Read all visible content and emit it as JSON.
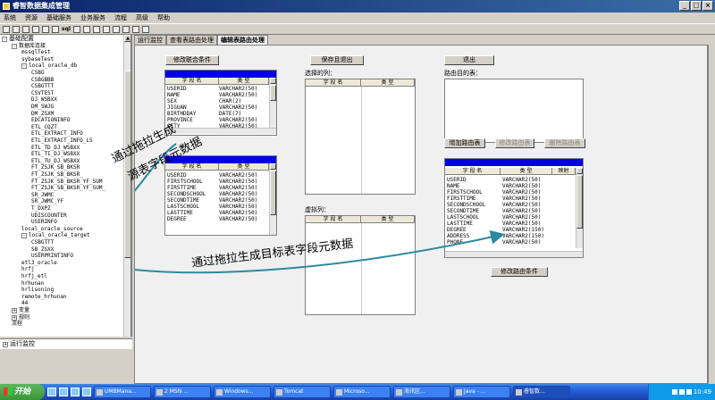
{
  "window": {
    "title": "睿智数据集成管理"
  },
  "menu": [
    "系统",
    "资源",
    "基础服务",
    "业务服务",
    "流程",
    "高级",
    "帮助"
  ],
  "toolbar": {
    "sql_label": "sql"
  },
  "tree": {
    "header": "基础配置",
    "nodes": [
      {
        "label": "基础配置",
        "level": 0,
        "expander": "-",
        "root": true
      },
      {
        "label": "数据库连接",
        "level": 1,
        "expander": "-"
      },
      {
        "label": "mssqlTest",
        "level": 2,
        "expander": ""
      },
      {
        "label": "sybaseTest",
        "level": 2,
        "expander": ""
      },
      {
        "label": "local_oracle_db",
        "level": 2,
        "expander": "-"
      },
      {
        "label": "CSBG",
        "level": 3,
        "expander": ""
      },
      {
        "label": "CSBGBBB",
        "level": 3,
        "expander": ""
      },
      {
        "label": "CSBGTTT",
        "level": 3,
        "expander": ""
      },
      {
        "label": "CSVTEST",
        "level": 3,
        "expander": ""
      },
      {
        "label": "DJ_WSBXX",
        "level": 3,
        "expander": ""
      },
      {
        "label": "DM_SWJG",
        "level": 3,
        "expander": ""
      },
      {
        "label": "DM_ZSXM",
        "level": 3,
        "expander": ""
      },
      {
        "label": "EDCATIONINFO",
        "level": 3,
        "expander": ""
      },
      {
        "label": "ETL_CQZT",
        "level": 3,
        "expander": ""
      },
      {
        "label": "ETL_EXTRACT_INFO",
        "level": 3,
        "expander": ""
      },
      {
        "label": "ETL_EXTRACT_INFO_LS",
        "level": 3,
        "expander": ""
      },
      {
        "label": "ETL_TD_DJ_WSBXX",
        "level": 3,
        "expander": ""
      },
      {
        "label": "ETL_TI_DJ_WSBXX",
        "level": 3,
        "expander": ""
      },
      {
        "label": "ETL_TU_DJ_WSBXX",
        "level": 3,
        "expander": ""
      },
      {
        "label": "FT_ZSJK_SB_BKSR",
        "level": 3,
        "expander": ""
      },
      {
        "label": "FT_ZSJK_SB_BKSR_",
        "level": 3,
        "expander": ""
      },
      {
        "label": "FT_ZSJK_SB_BKSR_YF_SUM",
        "level": 3,
        "expander": ""
      },
      {
        "label": "FT_ZSJK_SB_BKSR_YF_SUM_",
        "level": 3,
        "expander": ""
      },
      {
        "label": "SR_JWMC",
        "level": 3,
        "expander": ""
      },
      {
        "label": "SR_JWMC_YF",
        "level": 3,
        "expander": ""
      },
      {
        "label": "T_DXPZ",
        "level": 3,
        "expander": ""
      },
      {
        "label": "UDISCOUNTER",
        "level": 3,
        "expander": ""
      },
      {
        "label": "USERINFO",
        "level": 3,
        "expander": ""
      },
      {
        "label": "local_oracle_source",
        "level": 2,
        "expander": ""
      },
      {
        "label": "local_oracle_target",
        "level": 2,
        "expander": "-"
      },
      {
        "label": "CSBGTTT",
        "level": 3,
        "expander": ""
      },
      {
        "label": "SB_ZSXX",
        "level": 3,
        "expander": ""
      },
      {
        "label": "USERPRINTINFO",
        "level": 3,
        "expander": ""
      },
      {
        "label": "etl3_oracle",
        "level": 2,
        "expander": ""
      },
      {
        "label": "hrfj",
        "level": 2,
        "expander": ""
      },
      {
        "label": "hrfj_etl",
        "level": 2,
        "expander": ""
      },
      {
        "label": "hrhunan",
        "level": 2,
        "expander": ""
      },
      {
        "label": "hrlisoning",
        "level": 2,
        "expander": ""
      },
      {
        "label": "remote_hrhunan",
        "level": 2,
        "expander": ""
      },
      {
        "label": "44",
        "level": 2,
        "expander": ""
      },
      {
        "label": "变量",
        "level": 1,
        "expander": "+"
      },
      {
        "label": "规则",
        "level": 1,
        "expander": "+"
      },
      {
        "label": "流程",
        "level": 1,
        "expander": ""
      }
    ],
    "bottom_node": "运行监控"
  },
  "tabs": [
    {
      "label": "运行监控",
      "active": false
    },
    {
      "label": "查看表路由处理",
      "active": false
    },
    {
      "label": "编辑表路由处理",
      "active": true
    }
  ],
  "buttons": {
    "modify_join": "修改联合条件",
    "save_exit": "保存且退出",
    "exit": "退出",
    "add_route": "增加路由表",
    "modify_route": "修改路由表",
    "delete_route": "删除路由表",
    "modify_route_cond": "修改路由条件"
  },
  "labels": {
    "selected_cols": "选择的列：",
    "route_dest": "路由目的表：",
    "virtual_cols": "虚拟列："
  },
  "grid_headers": {
    "field": "字 段 名",
    "type": "类  型",
    "map": "映射"
  },
  "source_table": {
    "rows": [
      [
        "USERID",
        "VARCHAR2(50)"
      ],
      [
        "NAME",
        "VARCHAR2(50)"
      ],
      [
        "SEX",
        "CHAR(2)"
      ],
      [
        "JIGUAN",
        "VARCHAR2(50)"
      ],
      [
        "BIRTHDDAY",
        "DATE(7)"
      ],
      [
        "PROVINCE",
        "VARCHAR2(50)"
      ],
      [
        "CITY",
        "VARCHAR2(50)"
      ]
    ]
  },
  "source_table2": {
    "rows": [
      [
        "USERID",
        "VARCHAR2(50)"
      ],
      [
        "FIRSTSCHOOL",
        "VARCHAR2(50)"
      ],
      [
        "FIRSTTIME",
        "VARCHAR2(50)"
      ],
      [
        "SECONDSCHOOL",
        "VARCHAR2(50)"
      ],
      [
        "SECONDTIME",
        "VARCHAR2(50)"
      ],
      [
        "LASTSCHOOL",
        "VARCHAR2(50)"
      ],
      [
        "LASTTIME",
        "VARCHAR2(50)"
      ],
      [
        "DEGREE",
        "VARCHAR2(50)"
      ]
    ]
  },
  "target_table": {
    "rows": [
      [
        "USERID",
        "VARCHAR2(50)"
      ],
      [
        "NAME",
        "VARCHAR2(50)"
      ],
      [
        "FIRSTSCHOOL",
        "VARCHAR2(50)"
      ],
      [
        "FIRSTTIME",
        "VARCHAR2(50)"
      ],
      [
        "SECONDSCHOOL",
        "VARCHAR2(50)"
      ],
      [
        "SECONDTIME",
        "VARCHAR2(50)"
      ],
      [
        "LASTSCHOOL",
        "VARCHAR2(50)"
      ],
      [
        "LASTTIME",
        "VARCHAR2(50)"
      ],
      [
        "DEGREE",
        "VARCHAR2(150)"
      ],
      [
        "ADDRESS",
        "VARCHAR2(150)"
      ],
      [
        "PHONE",
        "VARCHAR2(50)"
      ]
    ]
  },
  "annotations": {
    "source_line1": "通过拖拉生成",
    "source_line2": "源表字段元数据",
    "target": "通过拖拉生成目标表字段元数据"
  },
  "taskbar": {
    "start": "开始",
    "tasks": [
      "UMBMana...",
      "2 MSN ...",
      "Windows...",
      "Tomcat",
      "Microso...",
      "海讯区...",
      "Java - ...",
      "睿智数..."
    ],
    "clock": "10:49"
  },
  "colors": {
    "title_bar": "#0a246a",
    "table_caption": "#0000e0",
    "taskbar": "#245edb"
  }
}
